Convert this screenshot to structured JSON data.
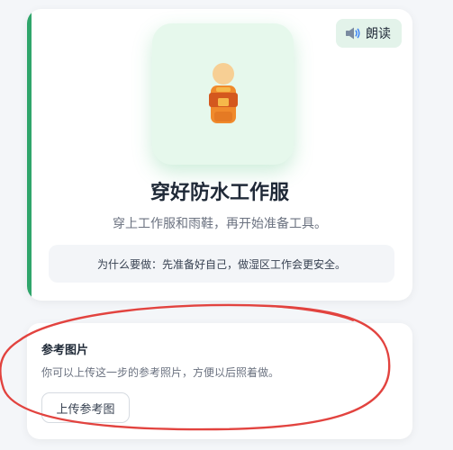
{
  "step_card": {
    "read_aloud_label": "朗读",
    "title": "穿好防水工作服",
    "description": "穿上工作服和雨鞋，再开始准备工具。",
    "why_text": "为什么要做：先准备好自己，做湿区工作会更安全。",
    "accent_color": "#2fa56b"
  },
  "reference_card": {
    "title": "参考图片",
    "description": "你可以上传这一步的参考照片，方便以后照着做。",
    "upload_label": "上传参考图"
  },
  "annotation": {
    "color": "#e2433f"
  }
}
